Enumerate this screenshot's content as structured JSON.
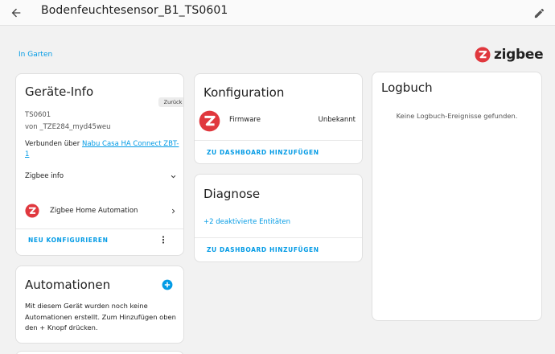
{
  "header": {
    "title": "Bodenfeuchtesensor_B1_TS0601",
    "back_icon": "arrow-left-icon",
    "edit_icon": "pencil-icon"
  },
  "area_link": "In Garten",
  "brand": {
    "name": "zigbee",
    "logo_color": "#e0383e"
  },
  "device_info": {
    "title": "Geräte-Info",
    "back_chip": "Zurück",
    "model": "TS0601",
    "manufacturer": "von _TZE284_myd45weu",
    "connected_prefix": "Verbunden über",
    "connected_link": "Nabu Casa HA Connect ZBT-1",
    "zigbee_info_label": "Zigbee info",
    "integration_label": "Zigbee Home Automation",
    "reconfigure_label": "NEU KONFIGURIEREN"
  },
  "automations": {
    "title": "Automationen",
    "body": "Mit diesem Gerät wurden noch keine Automationen erstellt. Zum Hinzufügen oben den + Knopf drücken."
  },
  "configuration": {
    "title": "Konfiguration",
    "firmware_label": "Firmware",
    "firmware_value": "Unbekannt",
    "add_dashboard_label": "ZU DASHBOARD HINZUFÜGEN"
  },
  "diagnostics": {
    "title": "Diagnose",
    "disabled_entities": "+2 deaktivierte Entitäten",
    "add_dashboard_label": "ZU DASHBOARD HINZUFÜGEN"
  },
  "logbook": {
    "title": "Logbuch",
    "empty_text": "Keine Logbuch-Ereignisse gefunden."
  },
  "colors": {
    "accent": "#039be5",
    "zigbee_red": "#e0383e"
  }
}
